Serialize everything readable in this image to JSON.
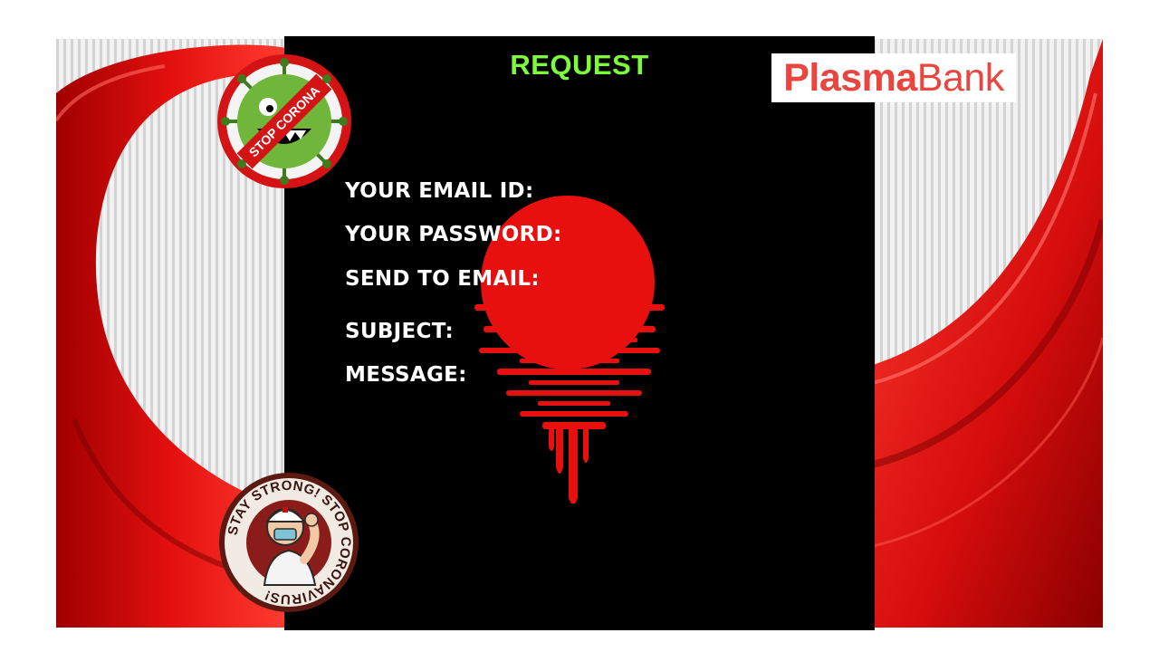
{
  "title": "REQUEST",
  "brand": {
    "part1": "Plasma",
    "part2": "Bank",
    "color": "#e8463f"
  },
  "form": {
    "labels": [
      "YOUR EMAIL ID:",
      "YOUR PASSWORD:",
      "SEND TO EMAIL:",
      "SUBJECT:",
      "MESSAGE:"
    ]
  },
  "badges": {
    "stop_corona": "STOP CORONA",
    "stay_strong": "STAY STRONG! STOP CORONAVIRUS!"
  },
  "colors": {
    "title": "#7CFC3A",
    "accent_red": "#e8100f",
    "panel": "#000000"
  },
  "icons": [
    "virus-icon",
    "nurse-icon",
    "blood-sun-icon"
  ]
}
